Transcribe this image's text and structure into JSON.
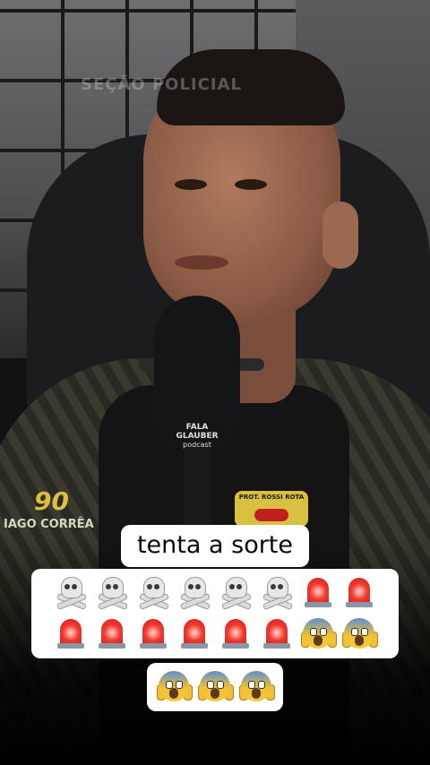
{
  "scene": {
    "watermark": "SEÇÃO POLICIAL",
    "mic_brand": "FALA GLAUBER",
    "mic_brand_sub": "podcast",
    "sleeve_number": "90",
    "sleeve_name": "IAGO CORRÊA",
    "badge_text": "PROT. ROSSI ROTA"
  },
  "caption": {
    "title": "tenta a sorte",
    "emoji_row1": [
      "skull-crossbones",
      "skull-crossbones",
      "skull-crossbones",
      "skull-crossbones",
      "skull-crossbones",
      "skull-crossbones",
      "police-light",
      "police-light"
    ],
    "emoji_row2": [
      "police-light",
      "police-light",
      "police-light",
      "police-light",
      "police-light",
      "police-light",
      "face-screaming-in-fear",
      "face-screaming-in-fear"
    ],
    "emoji_row3": [
      "face-screaming-in-fear",
      "face-screaming-in-fear",
      "face-screaming-in-fear"
    ]
  },
  "colors": {
    "caption_bg": "#ffffff",
    "caption_text": "#0a0a0a"
  }
}
